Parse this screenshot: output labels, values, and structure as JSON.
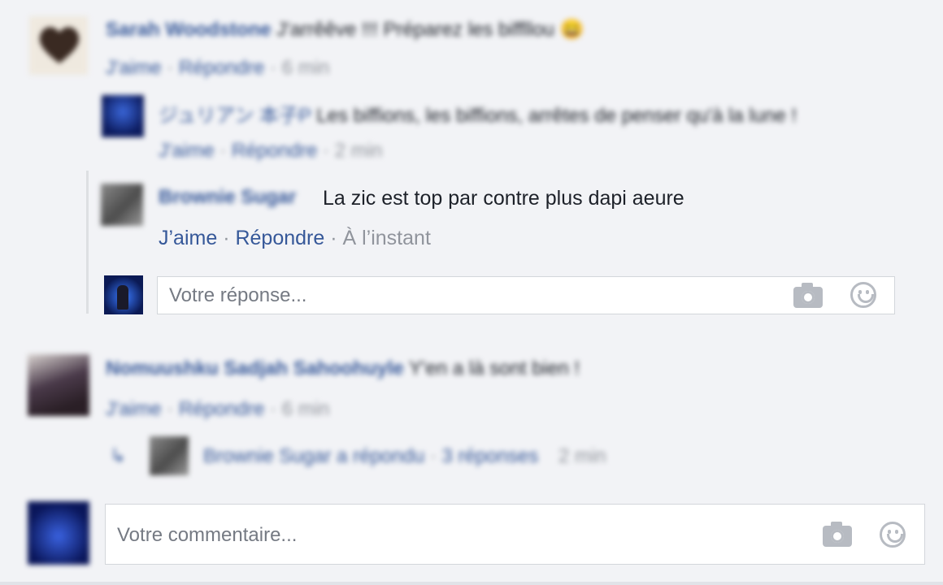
{
  "comments": [
    {
      "author": "Sarah Woodstone",
      "text": "J'arrêêve !!! Préparez les biffllou",
      "emoji": "😄",
      "like_label": "J'aime",
      "reply_label": "Répondre",
      "time": "6 min"
    },
    {
      "author": "Nomuushku Sadjah Sahoohuyle",
      "text": "Y'en a là sont bien !",
      "like_label": "J'aime",
      "reply_label": "Répondre",
      "time": "6 min",
      "replies_summary": {
        "author_phrase": "Brownie Sugar a répondu",
        "count_label": "3 réponses",
        "time": "2 min"
      }
    }
  ],
  "replies": [
    {
      "author": "ジュリアン 本子P",
      "text": "Les biffions, les biffions, arrêtes de penser qu'à la lune !",
      "like_label": "J'aime",
      "reply_label": "Répondre",
      "time": "2 min"
    },
    {
      "author": "Brownie Sugar",
      "text": "La zic est top par contre plus dapi aeure",
      "like_label": "J’aime",
      "reply_label": "Répondre",
      "time": "À l’instant"
    }
  ],
  "separators": {
    "dot": " · "
  },
  "reply_input": {
    "placeholder": "Votre réponse..."
  },
  "comment_input": {
    "placeholder": "Votre commentaire..."
  },
  "icons": {
    "camera": "camera-icon",
    "emoji": "smiley-icon",
    "reply_arrow": "reply-arrow-icon"
  },
  "colors": {
    "link": "#365899",
    "muted": "#90949c",
    "background": "#f2f3f6"
  }
}
